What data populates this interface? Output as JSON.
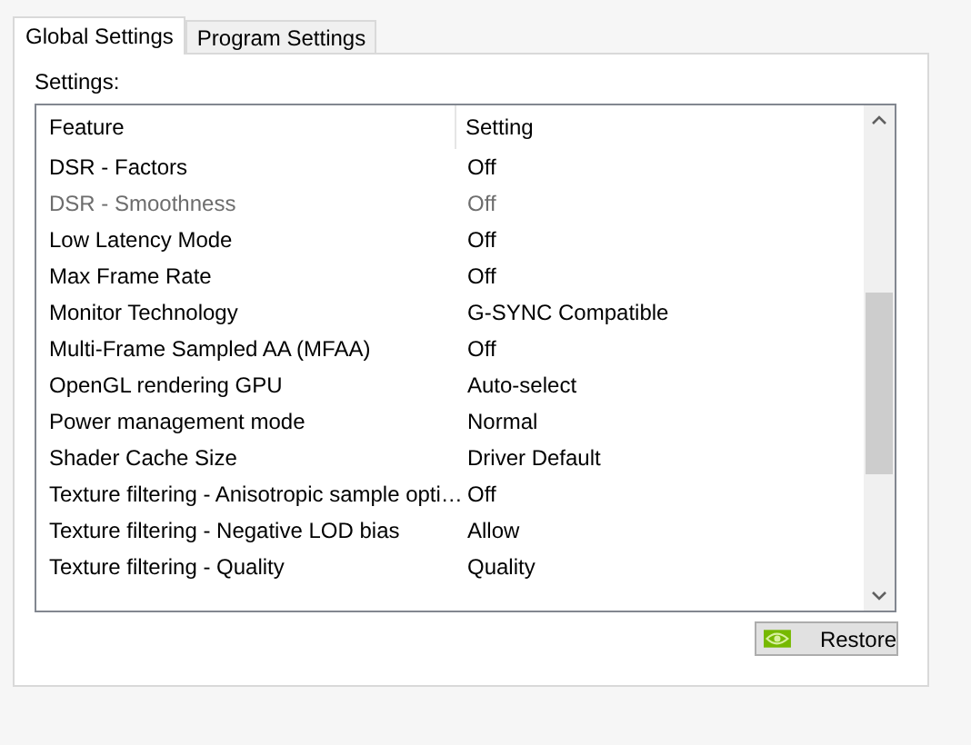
{
  "tabs": [
    {
      "label": "Global Settings",
      "selected": true
    },
    {
      "label": "Program Settings",
      "selected": false
    }
  ],
  "settings_label": "Settings:",
  "table": {
    "columns": [
      "Feature",
      "Setting"
    ],
    "rows": [
      {
        "feature": "DSR - Factors",
        "setting": "Off",
        "disabled": false
      },
      {
        "feature": "DSR - Smoothness",
        "setting": "Off",
        "disabled": true
      },
      {
        "feature": "Low Latency Mode",
        "setting": "Off",
        "disabled": false
      },
      {
        "feature": "Max Frame Rate",
        "setting": "Off",
        "disabled": false
      },
      {
        "feature": "Monitor Technology",
        "setting": "G-SYNC Compatible",
        "disabled": false
      },
      {
        "feature": "Multi-Frame Sampled AA (MFAA)",
        "setting": "Off",
        "disabled": false
      },
      {
        "feature": "OpenGL rendering GPU",
        "setting": "Auto-select",
        "disabled": false
      },
      {
        "feature": "Power management mode",
        "setting": "Normal",
        "disabled": false
      },
      {
        "feature": "Shader Cache Size",
        "setting": "Driver Default",
        "disabled": false
      },
      {
        "feature": "Texture filtering - Anisotropic sample opti…",
        "setting": "Off",
        "disabled": false
      },
      {
        "feature": "Texture filtering - Negative LOD bias",
        "setting": "Allow",
        "disabled": false
      },
      {
        "feature": "Texture filtering - Quality",
        "setting": "Quality",
        "disabled": false
      }
    ]
  },
  "restore_button": "Restore"
}
